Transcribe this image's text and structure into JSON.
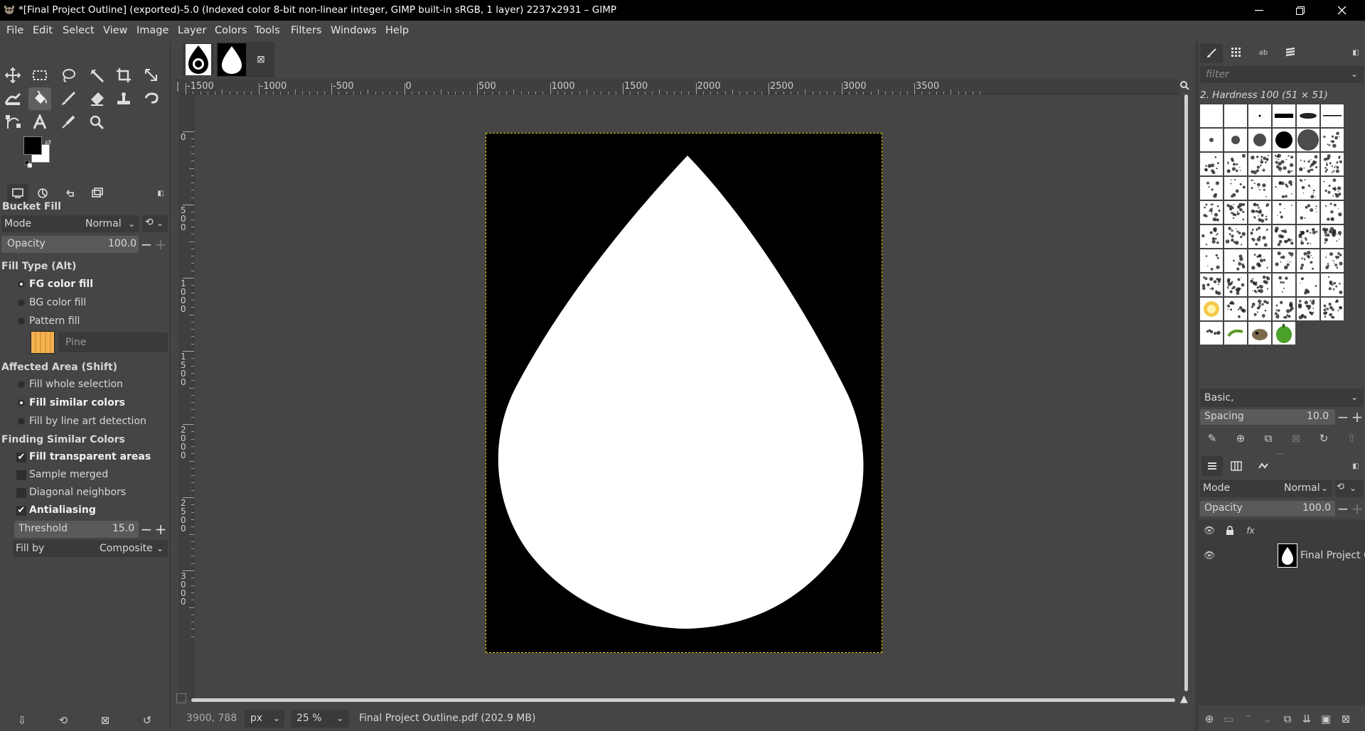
{
  "titlebar": {
    "title": "*[Final Project Outline] (exported)-5.0 (Indexed color 8-bit non-linear integer, GIMP built-in sRGB, 1 layer) 2237x2931 – GIMP"
  },
  "menu": [
    "File",
    "Edit",
    "Select",
    "View",
    "Image",
    "Layer",
    "Colors",
    "Tools",
    "Filters",
    "Windows",
    "Help"
  ],
  "tool_options": {
    "title": "Bucket Fill",
    "mode_label": "Mode",
    "mode_value": "Normal",
    "opacity_label": "Opacity",
    "opacity_value": "100.0",
    "fill_type_header": "Fill Type  (Alt)",
    "fill_types": [
      "FG color fill",
      "BG color fill",
      "Pattern fill"
    ],
    "pattern_name": "Pine",
    "affected_area_header": "Affected Area  (Shift)",
    "affected_areas": [
      "Fill whole selection",
      "Fill similar colors",
      "Fill by line art detection"
    ],
    "finding_header": "Finding Similar Colors",
    "finding_options": [
      "Fill transparent areas",
      "Sample merged",
      "Diagonal neighbors",
      "Antialiasing"
    ],
    "threshold_label": "Threshold",
    "threshold_value": "15.0",
    "fill_by_label": "Fill by",
    "fill_by_value": "Composite"
  },
  "ruler": {
    "h_labels": [
      "-1500",
      "-1000",
      "-500",
      "0",
      "500",
      "1000",
      "1500",
      "2000",
      "2500",
      "3000",
      "3500"
    ],
    "v_labels": [
      "0",
      "500",
      "1000",
      "1500",
      "2000",
      "2500",
      "3000"
    ]
  },
  "statusbar": {
    "coords": "3900, 788",
    "unit": "px",
    "zoom": "25 %",
    "file_info": "Final Project Outline.pdf (202.9 MB)"
  },
  "brushes": {
    "filter_placeholder": "filter",
    "selected_brush": "2. Hardness 100 (51 × 51)",
    "preset": "Basic,",
    "spacing_label": "Spacing",
    "spacing_value": "10.0"
  },
  "layers": {
    "mode_label": "Mode",
    "mode_value": "Normal",
    "opacity_label": "Opacity",
    "opacity_value": "100.0",
    "layer_name": "Final Project O"
  },
  "colors": {
    "fg": "#000000",
    "bg": "#ffffff",
    "selection_border": "#d6c400",
    "pattern_swatch": "#f2b250"
  }
}
